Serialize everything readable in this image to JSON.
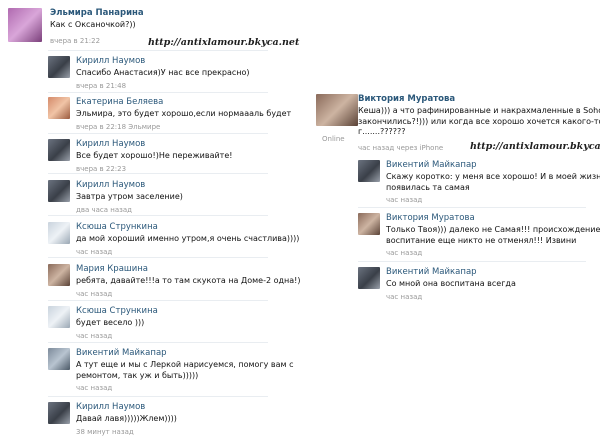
{
  "watermark": "http://antixlamour.bkyca.net",
  "left": [
    {
      "name": "Эльмира Панарина",
      "text": [
        "Как с Оксаночкой?))"
      ],
      "meta": "вчера в 21:22"
    },
    {
      "name": "Кирилл Наумов",
      "text": [
        "Спасибо Анастасия)У нас все прекрасно)"
      ],
      "meta": "вчера в 21:48"
    },
    {
      "name": "Екатерина Беляева",
      "text": [
        "Эльмира, это будет хорошо,если нормаааль будет"
      ],
      "meta": "вчера в 22:18 Эльмире"
    },
    {
      "name": "Кирилл Наумов",
      "text": [
        "Все будет хорошо!)Не переживайте!"
      ],
      "meta": "вчера в 22:23"
    },
    {
      "name": "Кирилл Наумов",
      "text": [
        "Завтра утром заселение)"
      ],
      "meta": "два часа назад"
    },
    {
      "name": "Ксюша Стрункина",
      "text": [
        "да мой хороший именно утром,я очень счастлива))))"
      ],
      "meta": "час назад"
    },
    {
      "name": "Мария Крашина",
      "text": [
        "ребята, давайте!!!а то там скукота на Доме-2 одна!)"
      ],
      "meta": "час назад"
    },
    {
      "name": "Ксюша Стрункина",
      "text": [
        "будет весело )))"
      ],
      "meta": "час назад"
    },
    {
      "name": "Викентий Майкапар",
      "text": [
        "А тут еще и мы с Леркой нарисуемся, помогу вам с",
        "ремонтом, так уж и быть)))))"
      ],
      "meta": "час назад"
    },
    {
      "name": "Кирилл Наумов",
      "text": [
        "Давай лавя)))))Жлем))))"
      ],
      "meta": "38 минут назад"
    }
  ],
  "right_main": {
    "name": "Виктория Муратова",
    "text": [
      "Кеша))) а что рафинированные и накрахмаленные в Soho",
      "закончились?!))) или когда все хорошо хочется какого-то",
      "г.......??????"
    ],
    "meta": "час назад через iPhone",
    "online": "Online"
  },
  "right_replies": [
    {
      "name": "Викентий Майкапар",
      "text": [
        "Скажу коротко: у меня все хорошо! И в моей жизни",
        "появилась та самая"
      ],
      "meta": "час назад"
    },
    {
      "name": "Виктория Муратова",
      "text": [
        "Только Твоя))) далеко не Самая!!! происхождение и",
        "воспитание еще никто не отменял!!! Извини"
      ],
      "meta": "час назад"
    },
    {
      "name": "Викентий Майкапар",
      "text": [
        "Со мной она воспитана всегда"
      ],
      "meta": "час назад"
    }
  ]
}
